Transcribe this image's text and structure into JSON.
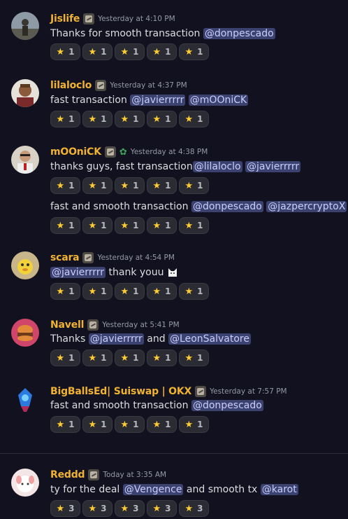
{
  "messages": [
    {
      "user": "Jislife",
      "time": "Yesterday at 4:10 PM",
      "lines": [
        {
          "text": "Thanks for smooth transaction ",
          "mentions": [
            "@donpescado"
          ]
        }
      ],
      "reactions": [
        "1",
        "1",
        "1",
        "1",
        "1"
      ]
    },
    {
      "user": "lilaloclo",
      "time": "Yesterday at 4:37 PM",
      "lines": [
        {
          "text": "fast transaction ",
          "mentions": [
            "@javierrrrr",
            "@mOOniCK"
          ]
        }
      ],
      "reactions": [
        "1",
        "1",
        "1",
        "1",
        "1"
      ]
    },
    {
      "user": "mOOniCK",
      "time": "Yesterday at 4:38 PM",
      "lines": [
        {
          "text": "thanks guys, fast transaction",
          "mentions": [
            "@lilaloclo",
            "@javierrrrr"
          ]
        },
        {
          "text": "fast and smooth transaction ",
          "mentions": [
            "@donpescado",
            "@jazpercryptoX"
          ]
        }
      ],
      "reactions": [
        "1",
        "1",
        "1",
        "1",
        "1"
      ],
      "reactions2": [
        "1",
        "1",
        "1",
        "1",
        "1"
      ]
    },
    {
      "user": "scara",
      "time": "Yesterday at 4:54 PM",
      "lines": [
        {
          "mention_first": "@javierrrrr",
          "text": " thank youu"
        }
      ],
      "reactions": [
        "1",
        "1",
        "1",
        "1",
        "1"
      ]
    },
    {
      "user": "Navell",
      "time": "Yesterday at 5:41 PM",
      "lines": [
        {
          "text": "Thanks ",
          "mentions": [
            "@javierrrrr"
          ],
          "mid": " and ",
          "mentions2": [
            "@LeonSalvatore"
          ]
        }
      ],
      "reactions": [
        "1",
        "1",
        "1",
        "1",
        "1"
      ]
    },
    {
      "user": "BigBallsEd| Suiswap | OKX",
      "time": "Yesterday at 7:57 PM",
      "lines": [
        {
          "text": "fast and smooth transaction ",
          "mentions": [
            "@donpescado"
          ]
        }
      ],
      "reactions": [
        "1",
        "1",
        "1",
        "1",
        "1"
      ]
    },
    {
      "user": "Reddd",
      "time": "Today at 3:35 AM",
      "lines": [
        {
          "text": "ty for the deal ",
          "mentions": [
            "@Vengence"
          ],
          "mid": " and smooth tx ",
          "mentions2": [
            "@karot"
          ]
        }
      ],
      "reactions": [
        "3",
        "3",
        "3",
        "3",
        "3"
      ]
    }
  ],
  "reaction_emoji": "★",
  "colors": {
    "username": "#f0b232",
    "mention_bg": "#3c4270",
    "mention_text": "#c9cdfb",
    "star": "#ffcc33",
    "background": "#12111f"
  }
}
